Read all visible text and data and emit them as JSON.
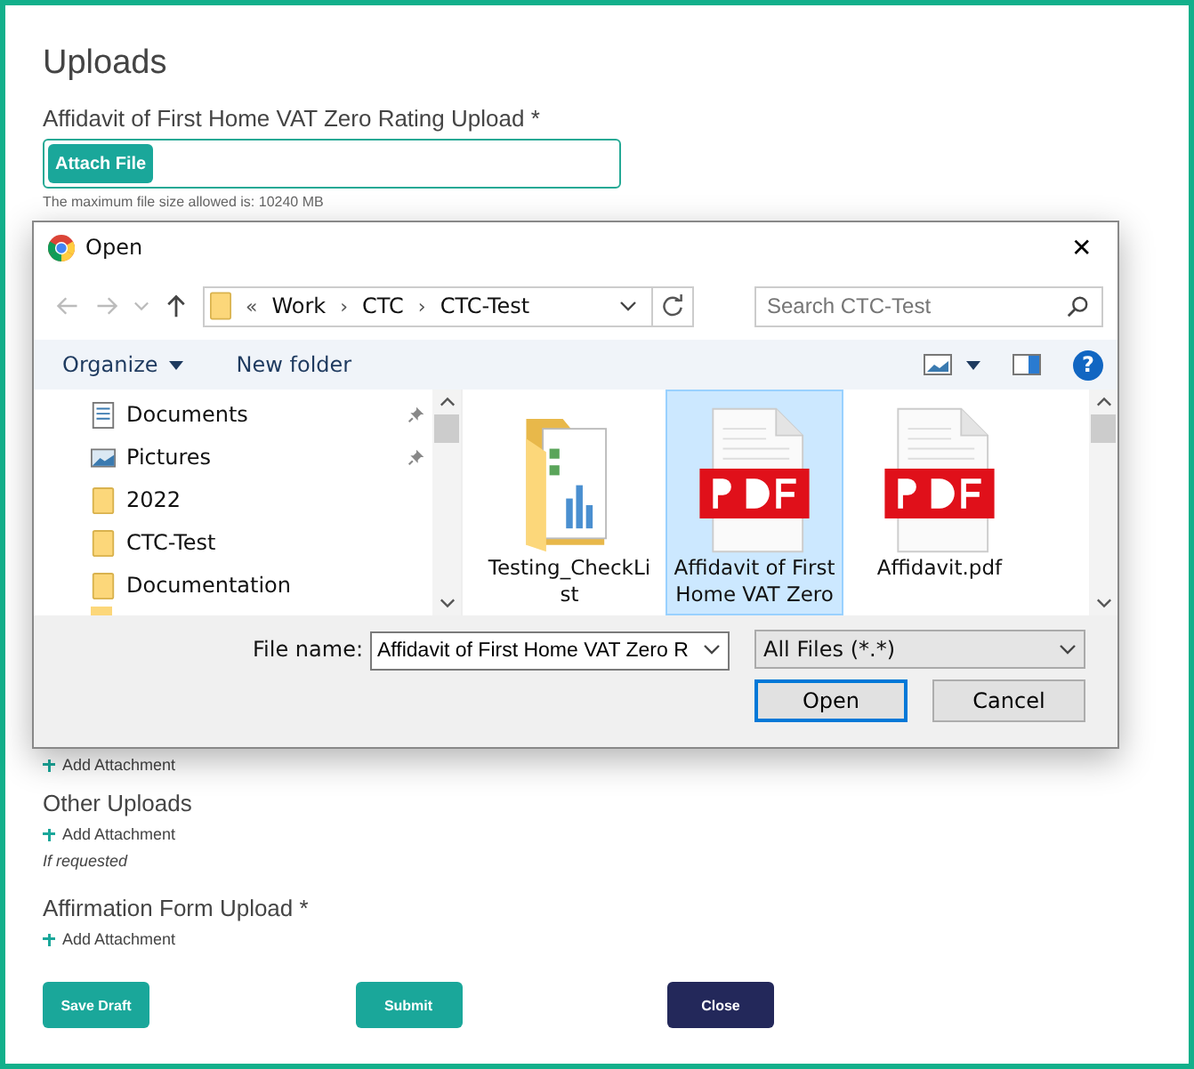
{
  "page": {
    "title": "Uploads"
  },
  "affidavit_upload": {
    "label": "Affidavit of First Home VAT Zero Rating Upload *",
    "button": "Attach File",
    "note": "The maximum file size allowed is: 10240 MB",
    "add_link": "Add Attachment"
  },
  "other_uploads": {
    "label": "Other Uploads",
    "add_link": "Add Attachment",
    "hint": "If requested"
  },
  "affirmation_upload": {
    "label": "Affirmation Form Upload *",
    "add_link": "Add Attachment"
  },
  "buttons": [
    {
      "label": "Save Draft",
      "kind": "primary"
    },
    {
      "label": "Submit",
      "kind": "primary"
    },
    {
      "label": "Close",
      "kind": "dark"
    }
  ],
  "dialog": {
    "title": "Open",
    "close": "✕",
    "breadcrumb": [
      "«",
      "Work",
      "›",
      "CTC",
      "›",
      "CTC-Test"
    ],
    "search": {
      "placeholder": "Search CTC-Test"
    },
    "toolbar": {
      "organize": "Organize",
      "new_folder": "New folder"
    },
    "sidebar": {
      "items": [
        {
          "label": "Documents",
          "kind": "documents",
          "pinned": true
        },
        {
          "label": "Pictures",
          "kind": "pictures",
          "pinned": true
        },
        {
          "label": "2022",
          "kind": "folder",
          "pinned": false
        },
        {
          "label": "CTC-Test",
          "kind": "folder",
          "pinned": false
        },
        {
          "label": "Documentation",
          "kind": "folder",
          "pinned": false
        }
      ]
    },
    "files": [
      {
        "name": "Testing_CheckList",
        "kind": "folder",
        "selected": false
      },
      {
        "name": "Affidavit of First Home VAT Zero",
        "kind": "pdf",
        "selected": true
      },
      {
        "name": "Affidavit.pdf",
        "kind": "pdf",
        "selected": false
      }
    ],
    "file_name": {
      "label": "File name:",
      "value": "Affidavit of First Home VAT Zero R"
    },
    "file_type": "All Files (*.*)",
    "help": "?",
    "open_button": "Open",
    "cancel_button": "Cancel"
  }
}
